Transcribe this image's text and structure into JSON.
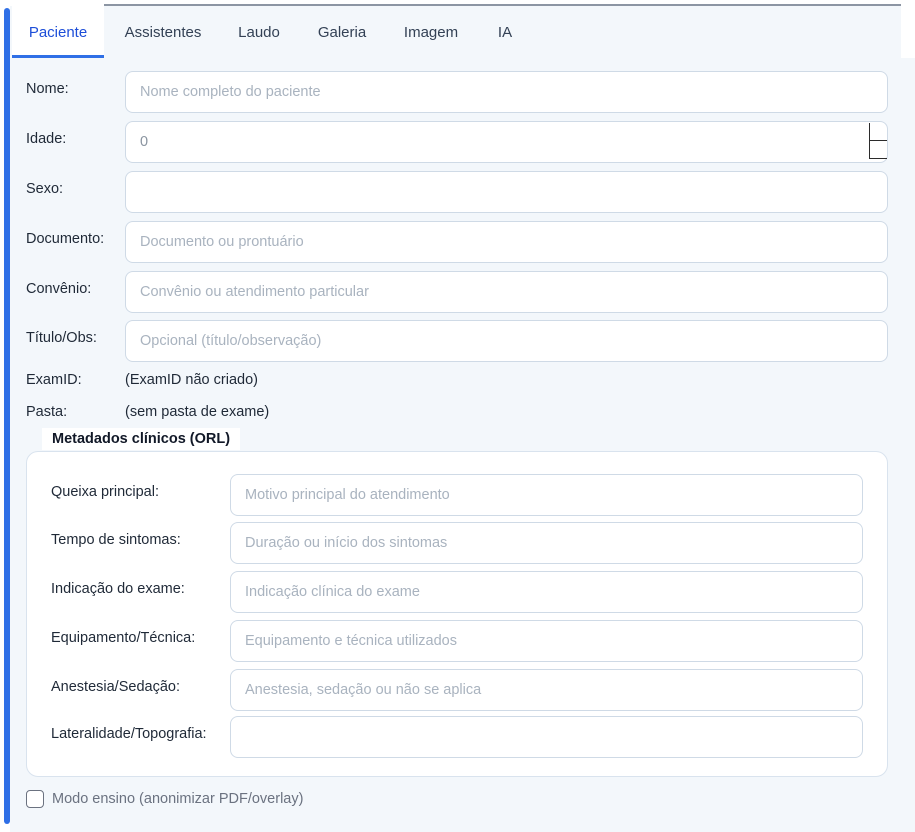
{
  "tabs": [
    {
      "label": "Paciente",
      "active": true
    },
    {
      "label": "Assistentes"
    },
    {
      "label": "Laudo"
    },
    {
      "label": "Galeria"
    },
    {
      "label": "Imagem"
    },
    {
      "label": "IA"
    }
  ],
  "patient": {
    "name": {
      "label": "Nome:",
      "value": "",
      "placeholder": "Nome completo do paciente"
    },
    "age": {
      "label": "Idade:",
      "value": "0"
    },
    "sex": {
      "label": "Sexo:",
      "value": ""
    },
    "document": {
      "label": "Documento:",
      "value": "",
      "placeholder": "Documento ou prontuário"
    },
    "insurance": {
      "label": "Convênio:",
      "value": "",
      "placeholder": "Convênio ou atendimento particular"
    },
    "title": {
      "label": "Título/Obs:",
      "value": "",
      "placeholder": "Opcional (título/observação)"
    },
    "exam_id": {
      "label": "ExamID:",
      "value": "(ExamID não criado)"
    },
    "folder": {
      "label": "Pasta:",
      "value": "(sem pasta de exame)"
    }
  },
  "clinical": {
    "title": "Metadados clínicos (ORL)",
    "complaint": {
      "label": "Queixa principal:",
      "value": "",
      "placeholder": "Motivo principal do atendimento"
    },
    "symptom_time": {
      "label": "Tempo de sintomas:",
      "value": "",
      "placeholder": "Duração ou início dos sintomas"
    },
    "indication": {
      "label": "Indicação do exame:",
      "value": "",
      "placeholder": "Indicação clínica do exame"
    },
    "equipment": {
      "label": "Equipamento/Técnica:",
      "value": "",
      "placeholder": "Equipamento e técnica utilizados"
    },
    "anesthesia": {
      "label": "Anestesia/Sedação:",
      "value": "",
      "placeholder": "Anestesia, sedação ou não se aplica"
    },
    "laterality": {
      "label": "Lateralidade/Topografia:",
      "value": "",
      "placeholder": ""
    }
  },
  "teaching_mode": {
    "label": "Modo ensino (anonimizar PDF/overlay)",
    "checked": false
  },
  "colors": {
    "accent": "#2f6fe6",
    "panel_bg": "#f3f7fb",
    "border": "#cfdae6"
  }
}
